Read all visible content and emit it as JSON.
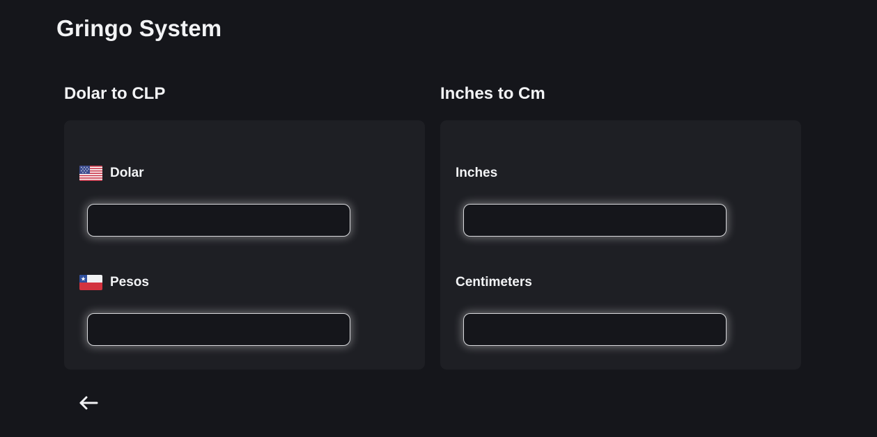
{
  "app": {
    "title": "Gringo System"
  },
  "currency_converter": {
    "title": "Dolar to CLP",
    "from": {
      "label": "Dolar",
      "icon": "us-flag-icon",
      "value": "",
      "placeholder": ""
    },
    "to": {
      "label": "Pesos",
      "icon": "chile-flag-icon",
      "value": "",
      "placeholder": ""
    }
  },
  "length_converter": {
    "title": "Inches to Cm",
    "from": {
      "label": "Inches",
      "value": "",
      "placeholder": ""
    },
    "to": {
      "label": "Centimeters",
      "value": "",
      "placeholder": ""
    }
  },
  "navigation": {
    "back_icon": "arrow-left-icon"
  },
  "colors": {
    "background": "#15161b",
    "card": "#1e1f24",
    "text": "#f2f3f5",
    "input_border": "#d9dadd"
  }
}
